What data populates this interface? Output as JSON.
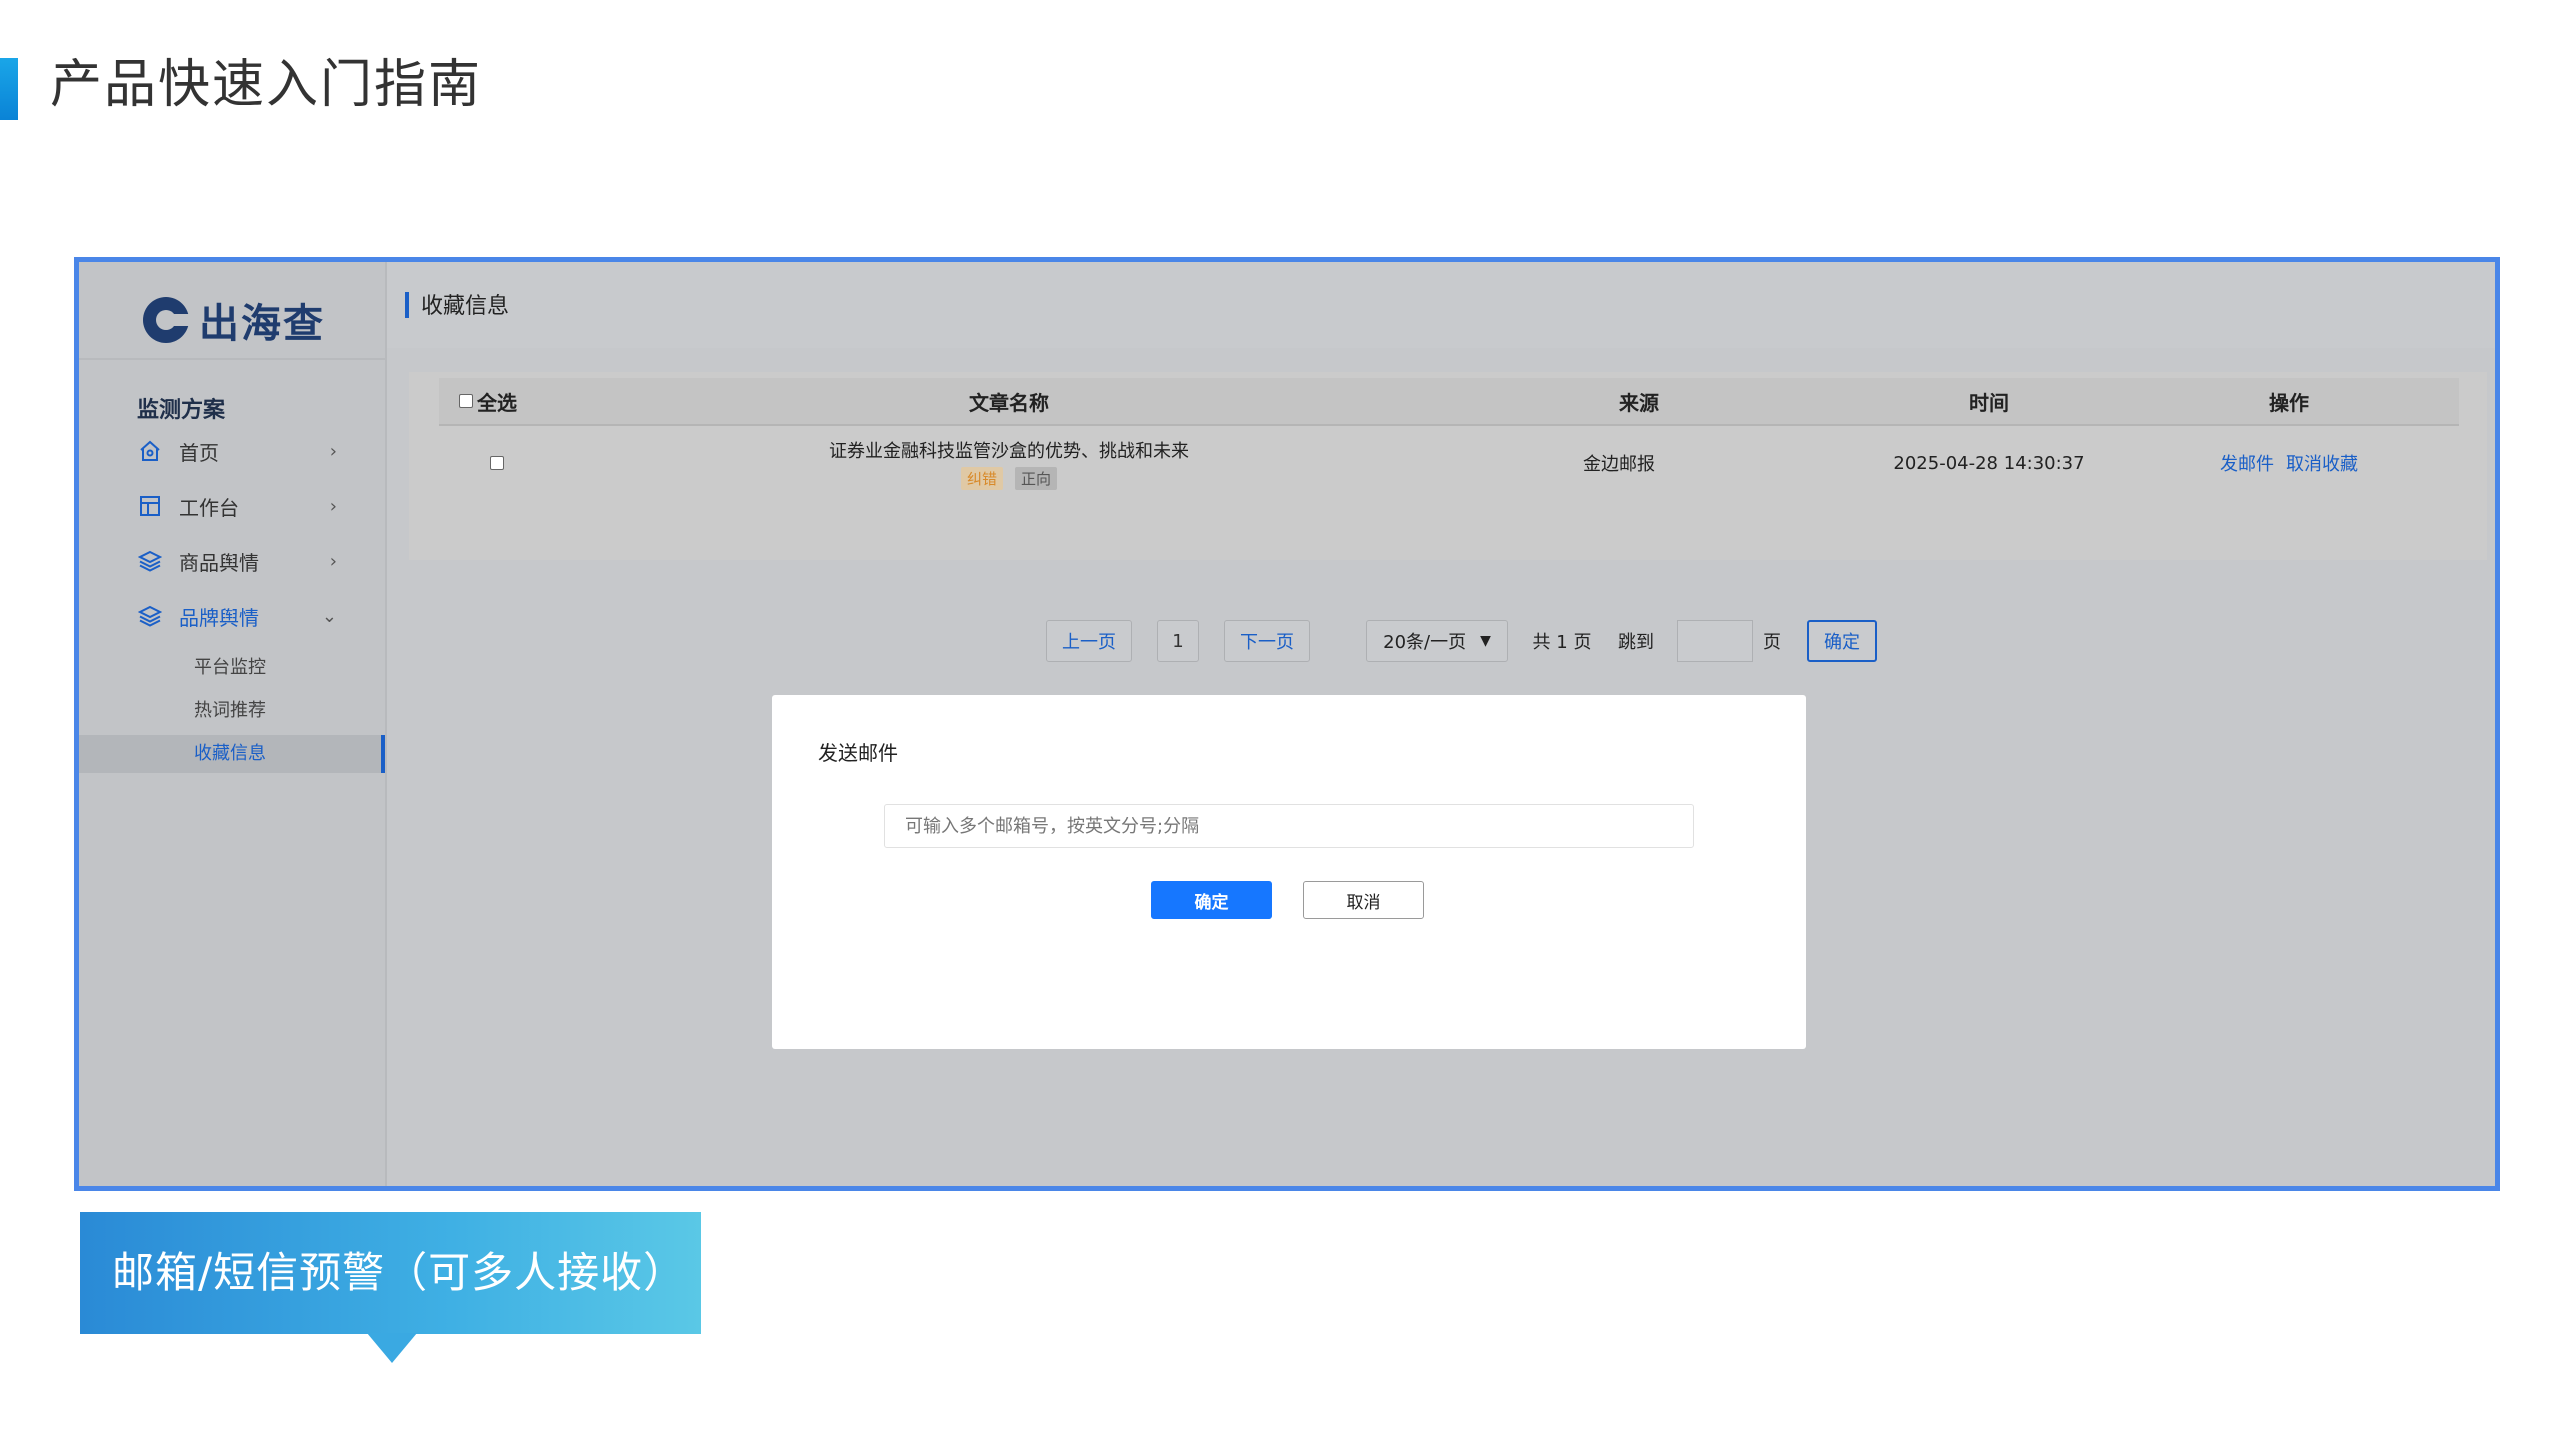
{
  "slide": {
    "title": "产品快速入门指南",
    "caption": "邮箱/短信预警（可多人接收）"
  },
  "app": {
    "logo_text": "出海查",
    "sidebar": {
      "section_title": "监测方案",
      "items": [
        {
          "label": "首页",
          "icon": "home-icon",
          "chevron": "›"
        },
        {
          "label": "工作台",
          "icon": "layout-icon",
          "chevron": "›"
        },
        {
          "label": "商品舆情",
          "icon": "layers-icon",
          "chevron": "›"
        },
        {
          "label": "品牌舆情",
          "icon": "layers-icon",
          "chevron": "⌄"
        }
      ],
      "sub_items": [
        {
          "label": "平台监控"
        },
        {
          "label": "热词推荐"
        },
        {
          "label": "收藏信息"
        }
      ]
    },
    "header": {
      "title": "收藏信息"
    },
    "table": {
      "select_all": "全选",
      "columns": [
        "文章名称",
        "来源",
        "时间",
        "操作"
      ],
      "rows": [
        {
          "title": "证券业金融科技监管沙盒的优势、挑战和未来",
          "tags": [
            "纠错",
            "正向"
          ],
          "source": "金边邮报",
          "time": "2025-04-28 14:30:37",
          "actions": [
            "发邮件",
            "取消收藏"
          ]
        }
      ]
    },
    "pagination": {
      "prev": "上一页",
      "page": "1",
      "next": "下一页",
      "page_size": "20条/一页",
      "total": "共 1 页",
      "jump_label": "跳到",
      "page_unit": "页",
      "ok": "确定"
    },
    "modal": {
      "title": "发送邮件",
      "placeholder": "可输入多个邮箱号，按英文分号;分隔",
      "ok": "确定",
      "cancel": "取消"
    }
  },
  "colors": {
    "accent": "#1a5fc7",
    "primary_button": "#1677ff",
    "frame_border": "#4a86e8",
    "tag_orange": "#d88a2a"
  }
}
